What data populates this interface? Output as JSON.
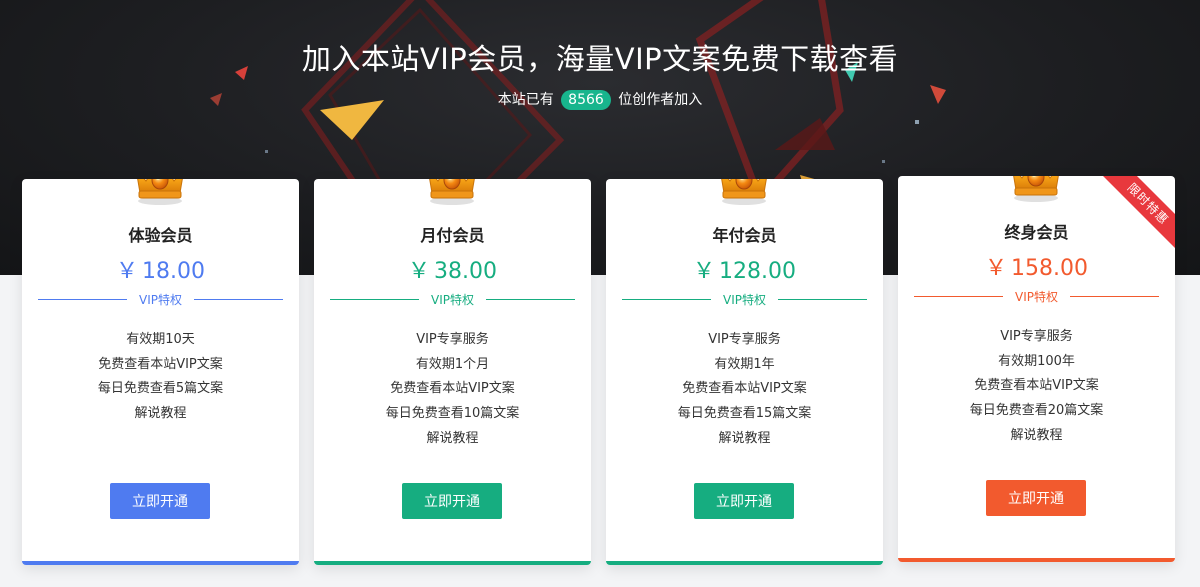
{
  "hero": {
    "title": "加入本站VIP会员，海量VIP文案免费下载查看",
    "subtitle_prefix": "本站已有",
    "member_count": "8566",
    "subtitle_suffix": "位创作者加入"
  },
  "colors": {
    "blue": "#4f7bf0",
    "green": "#16ad80",
    "orange": "#f25a2e",
    "ribbon": "#e8383d"
  },
  "plans": [
    {
      "title": "体验会员",
      "currency": "￥",
      "price": "18.00",
      "divider_label": "VIP特权",
      "features": [
        "有效期10天",
        "免费查看本站VIP文案",
        "每日免费查看5篇文案",
        "解说教程"
      ],
      "button_label": "立即开通"
    },
    {
      "title": "月付会员",
      "currency": "￥",
      "price": "38.00",
      "divider_label": "VIP特权",
      "features": [
        "VIP专享服务",
        "有效期1个月",
        "免费查看本站VIP文案",
        "每日免费查看10篇文案",
        "解说教程"
      ],
      "button_label": "立即开通"
    },
    {
      "title": "年付会员",
      "currency": "￥",
      "price": "128.00",
      "divider_label": "VIP特权",
      "features": [
        "VIP专享服务",
        "有效期1年",
        "免费查看本站VIP文案",
        "每日免费查看15篇文案",
        "解说教程"
      ],
      "button_label": "立即开通"
    },
    {
      "title": "终身会员",
      "currency": "￥",
      "price": "158.00",
      "divider_label": "VIP特权",
      "features": [
        "VIP专享服务",
        "有效期100年",
        "免费查看本站VIP文案",
        "每日免费查看20篇文案",
        "解说教程"
      ],
      "button_label": "立即开通",
      "ribbon": "限时特惠"
    }
  ]
}
